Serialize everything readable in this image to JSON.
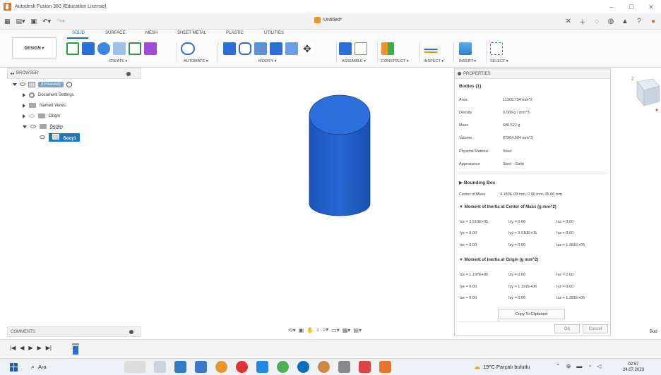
{
  "window": {
    "title": "Autodesk Fusion 360 (Education License)",
    "min": "–",
    "max": "☐",
    "close": "✕"
  },
  "document": {
    "name": "Untitled*"
  },
  "ribbon": {
    "workspace": "DESIGN ▾",
    "tabs": [
      "SOLID",
      "SURFACE",
      "MESH",
      "SHEET METAL",
      "PLASTIC",
      "UTILITIES"
    ],
    "groups": [
      "CREATE ▾",
      "AUTOMATE ▾",
      "MODIFY ▾",
      "ASSEMBLE ▾",
      "CONSTRUCT ▾",
      "INSPECT ▾",
      "INSERT ▾",
      "SELECT ▾"
    ]
  },
  "browser": {
    "title": "BROWSER",
    "root": "(Unsaved)",
    "items": [
      "Document Settings",
      "Named Views",
      "Origin",
      "Bodies",
      "Body1"
    ]
  },
  "comments": {
    "title": "COMMENTS"
  },
  "properties": {
    "title": "PROPERTIES",
    "bodies_title": "Bodies (1)",
    "rows": [
      {
        "k": "Area",
        "v": "11309.734 mm^2"
      },
      {
        "k": "Density",
        "v": "0.008 g / mm^3"
      },
      {
        "k": "Mass",
        "v": "690.522 g"
      },
      {
        "k": "Volume",
        "v": "87964.594 mm^3"
      },
      {
        "k": "Physical Material",
        "v": "Steel"
      },
      {
        "k": "Appearance",
        "v": "Steel - Satin"
      }
    ],
    "bounding_box": "Bounding Box",
    "center_of_mass_label": "Center of Mass",
    "center_of_mass": "4.183E-09 mm, 0.00 mm, 35.00 mm",
    "moi_center_title": "Moment of Inertia at Center of Mass   (g mm^2)",
    "moi_center": [
      [
        "Ixx = 3.510E+05",
        "Ixy = 0.00",
        "Ixz = 0.00"
      ],
      [
        "Iyx = 0.00",
        "Iyy = 3.510E+05",
        "Iyz = 0.00"
      ],
      [
        "Izx = 0.00",
        "Izy = 0.00",
        "Izz = 1.381E+05"
      ]
    ],
    "moi_origin_title": "Moment of Inertia at Origin   (g mm^2)",
    "moi_origin": [
      [
        "Ixx = 1.197E+06",
        "Ixy = 0.00",
        "Ixz = 0.00"
      ],
      [
        "Iyx = 0.00",
        "Iyy = 1.197E+06",
        "Iyz = 0.00"
      ],
      [
        "Izx = 0.00",
        "Izy = 0.00",
        "Izz = 1.381E+05"
      ]
    ],
    "copy": "Copy To Clipboard",
    "ok": "OK",
    "cancel": "Cancel"
  },
  "side_label": "Bod",
  "taskbar": {
    "search": "Ara",
    "weather": "19°C  Parçalı bulutlu",
    "time": "02:57",
    "date": "24.07.2023"
  },
  "colors": {
    "body_blue": "#1f5cc4",
    "accent": "#0f6fb7"
  }
}
